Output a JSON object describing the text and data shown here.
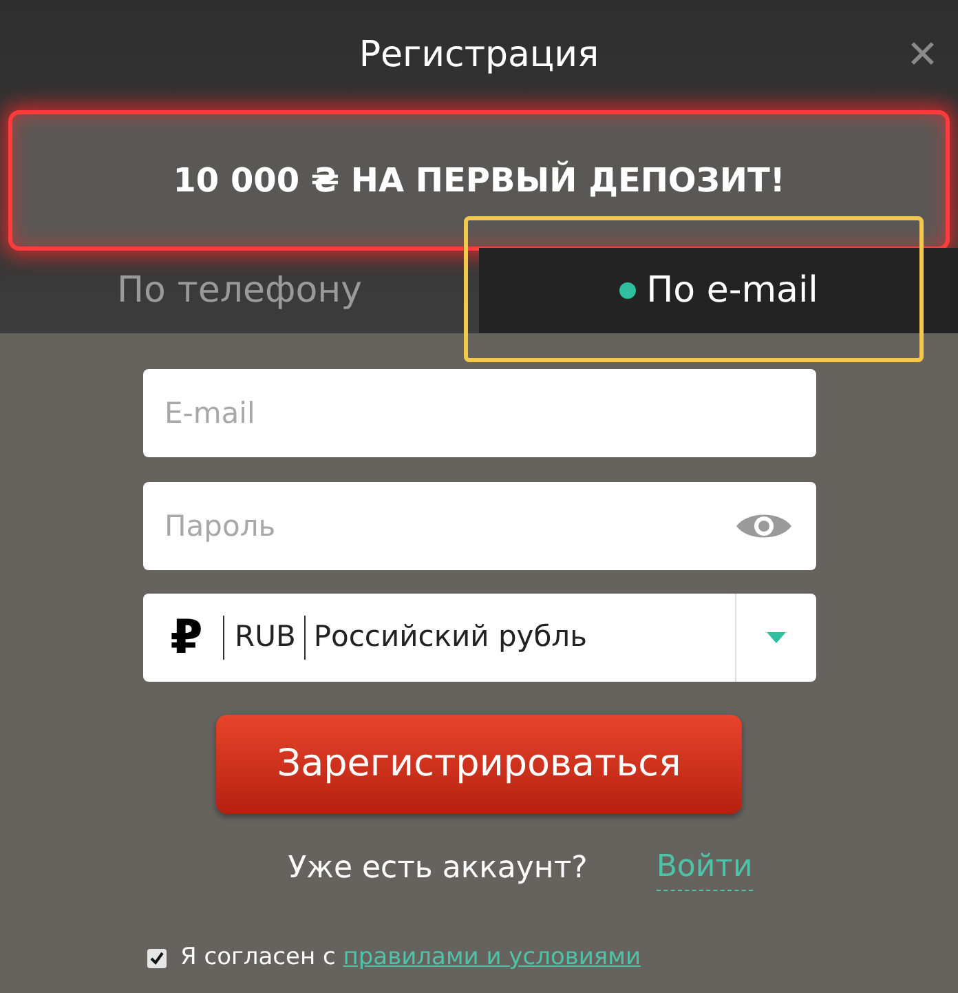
{
  "dialog": {
    "title": "Регистрация",
    "close_icon": "✕"
  },
  "promo": {
    "text": "10 000 ₴ НА ПЕРВЫЙ ДЕПОЗИТ!"
  },
  "tabs": [
    {
      "label": "По телефону",
      "selected": false
    },
    {
      "label": "По e-mail",
      "selected": true,
      "highlighted": true
    }
  ],
  "form": {
    "email": {
      "placeholder": "E-mail"
    },
    "password": {
      "placeholder": "Пароль"
    },
    "currency": {
      "symbol": "₽",
      "code": "RUB",
      "name": "Российский рубль"
    },
    "submit": "Зарегистрироваться"
  },
  "login": {
    "text": "Уже есть аккаунт?",
    "link": "Войти"
  },
  "agreement": {
    "checked": true,
    "text": "Я согласен с",
    "link": "правилами и условиями"
  }
}
